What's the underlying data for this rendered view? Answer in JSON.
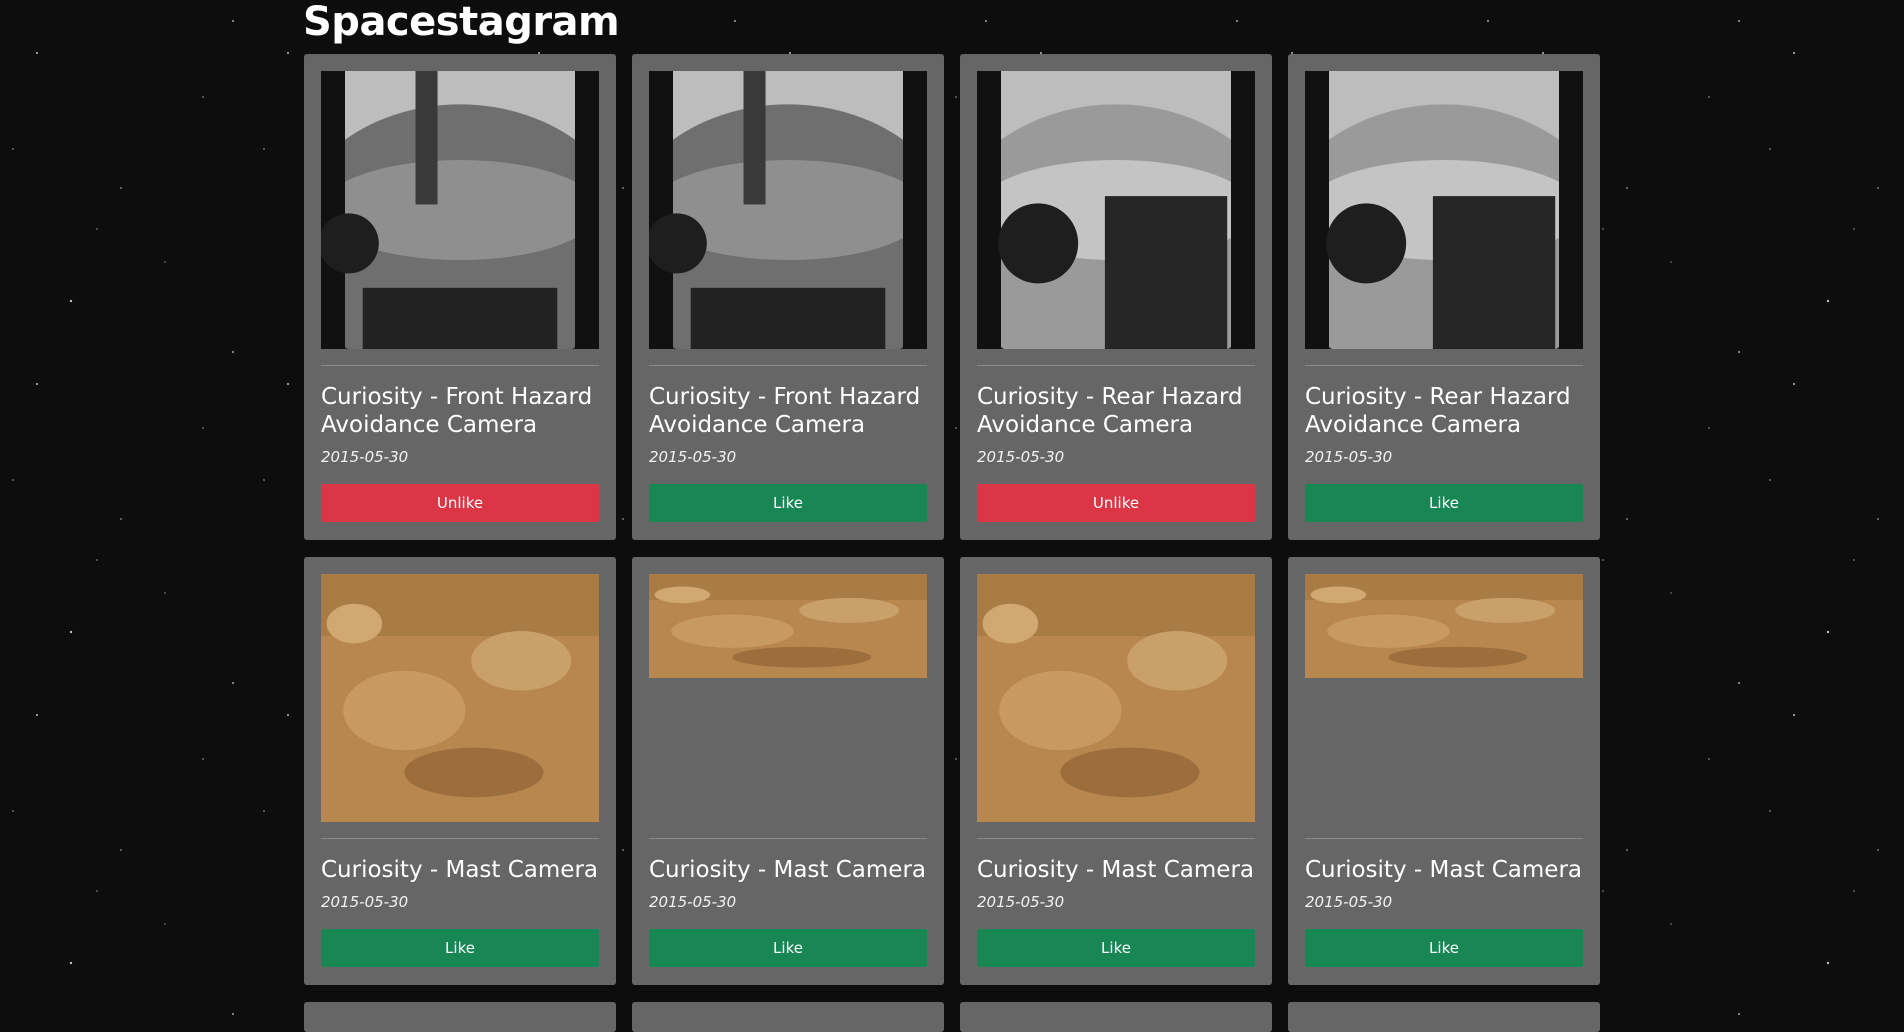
{
  "header": {
    "title": "Spacestagram"
  },
  "colors": {
    "like": "#198754",
    "unlike": "#dc3545",
    "card": "#666666",
    "background": "#0d0d0d"
  },
  "photos": [
    {
      "camera": "Curiosity - Front Hazard Avoidance Camera",
      "date": "2015-05-30",
      "button": "Unlike",
      "style": "hazard-front",
      "liked": true
    },
    {
      "camera": "Curiosity - Front Hazard Avoidance Camera",
      "date": "2015-05-30",
      "button": "Like",
      "style": "hazard-front",
      "liked": false
    },
    {
      "camera": "Curiosity - Rear Hazard Avoidance Camera",
      "date": "2015-05-30",
      "button": "Unlike",
      "style": "hazard-rear",
      "liked": true
    },
    {
      "camera": "Curiosity - Rear Hazard Avoidance Camera",
      "date": "2015-05-30",
      "button": "Like",
      "style": "hazard-rear",
      "liked": false
    },
    {
      "camera": "Curiosity - Mast Camera",
      "date": "2015-05-30",
      "button": "Like",
      "style": "mast-tall",
      "liked": false
    },
    {
      "camera": "Curiosity - Mast Camera",
      "date": "2015-05-30",
      "button": "Like",
      "style": "mast-wide",
      "liked": false
    },
    {
      "camera": "Curiosity - Mast Camera",
      "date": "2015-05-30",
      "button": "Like",
      "style": "mast-tall",
      "liked": false
    },
    {
      "camera": "Curiosity - Mast Camera",
      "date": "2015-05-30",
      "button": "Like",
      "style": "mast-wide",
      "liked": false
    }
  ]
}
